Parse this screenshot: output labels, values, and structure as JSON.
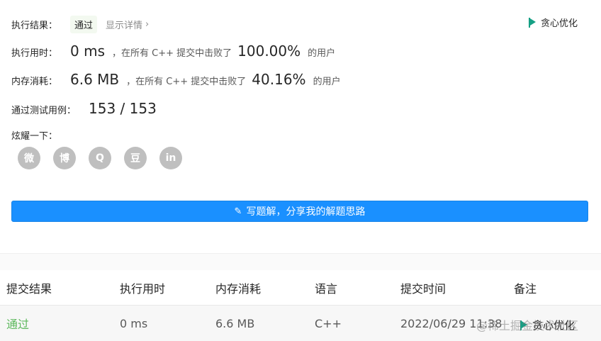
{
  "result": {
    "label": "执行结果：",
    "status": "通过",
    "detail_link": "显示详情",
    "detail_chevron": "›"
  },
  "greedy": {
    "label": "贪心优化",
    "icon": "flag-icon",
    "color": "#16a085"
  },
  "runtime": {
    "label": "执行用时：",
    "value": "0 ms",
    "text": "，在所有 C++ 提交中击败了",
    "percent": "100.00%",
    "suffix": "的用户"
  },
  "memory": {
    "label": "内存消耗：",
    "value": "6.6 MB",
    "text": "，在所有 C++ 提交中击败了",
    "percent": "40.16%",
    "suffix": "的用户"
  },
  "cases": {
    "label": "通过测试用例：",
    "value": "153 / 153"
  },
  "share": {
    "label": "炫耀一下：",
    "items": [
      {
        "icon": "wechat-icon",
        "glyph": "微"
      },
      {
        "icon": "weibo-icon",
        "glyph": "博"
      },
      {
        "icon": "qq-icon",
        "glyph": "Q"
      },
      {
        "icon": "douban-icon",
        "glyph": "豆"
      },
      {
        "icon": "linkedin-icon",
        "glyph": "in"
      }
    ]
  },
  "write_button": {
    "label": "写题解，分享我的解题思路",
    "icon": "pencil-icon",
    "color": "#1a90ff"
  },
  "table": {
    "headers": [
      "提交结果",
      "执行用时",
      "内存消耗",
      "语言",
      "提交时间",
      "备注"
    ],
    "rows": [
      {
        "result": "通过",
        "time": "0 ms",
        "memory": "6.6 MB",
        "language": "C++",
        "submitted": "2022/06/29 11:38",
        "note": "贪心优化"
      }
    ]
  },
  "watermark": "@稀土掘金技术社区"
}
